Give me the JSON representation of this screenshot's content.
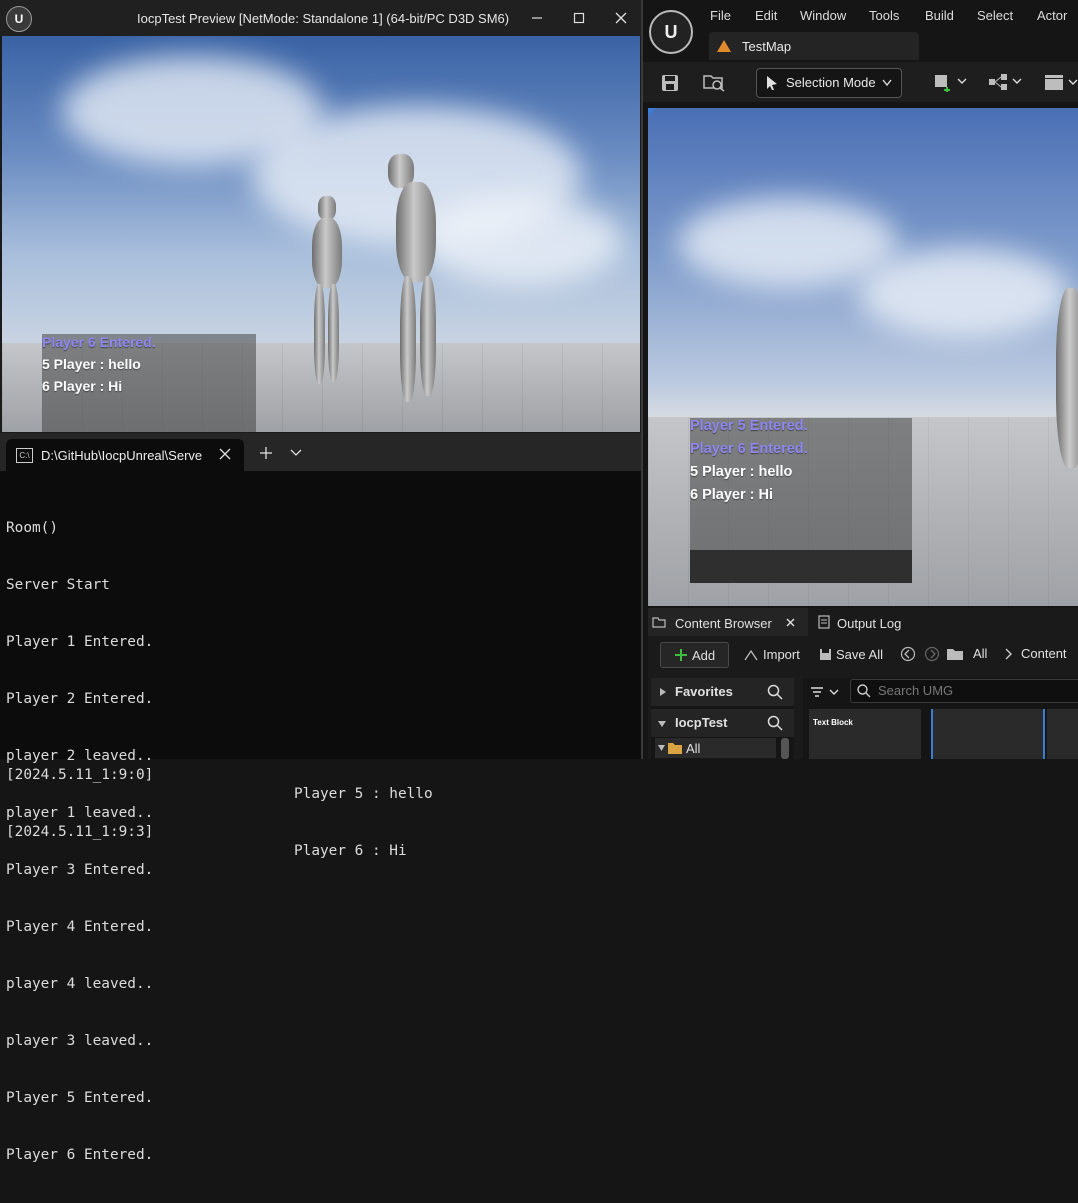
{
  "preview_window": {
    "title": "IocpTest Preview [NetMode: Standalone 1]  (64-bit/PC D3D SM6)",
    "chat": [
      {
        "text": "Player 6 Entered.",
        "color": "#8f86f0"
      },
      {
        "text": "5 Player : hello",
        "color": "#ffffff"
      },
      {
        "text": "6 Player : Hi",
        "color": "#ffffff"
      }
    ]
  },
  "terminal": {
    "tab_title": "D:\\GitHub\\IocpUnreal\\Serve",
    "lines": [
      "Room()",
      "Server Start",
      "Player 1 Entered.",
      "Player 2 Entered.",
      "player 2 leaved..",
      "player 1 leaved..",
      "Player 3 Entered.",
      "Player 4 Entered.",
      "player 4 leaved..",
      "player 3 leaved..",
      "Player 5 Entered.",
      "Player 6 Entered."
    ],
    "log": [
      {
        "time": "[2024.5.11_1:9:0]",
        "message": "Player 5 : hello"
      },
      {
        "time": "[2024.5.11_1:9:3]",
        "message": "Player 6 : Hi"
      }
    ]
  },
  "editor": {
    "menu": [
      "File",
      "Edit",
      "Window",
      "Tools",
      "Build",
      "Select",
      "Actor"
    ],
    "map_tab": "TestMap",
    "selection_mode": "Selection Mode",
    "chat": [
      {
        "text": "Player 5 Entered.",
        "color": "#8f86f0"
      },
      {
        "text": "Player 6 Entered.",
        "color": "#8f86f0"
      },
      {
        "text": "5 Player : hello",
        "color": "#ffffff"
      },
      {
        "text": "6 Player : Hi",
        "color": "#ffffff"
      }
    ],
    "content_browser": {
      "tab": "Content Browser",
      "output_log_tab": "Output Log",
      "add": "Add",
      "import": "Import",
      "save_all": "Save All",
      "path": [
        "All",
        "Content"
      ],
      "favorites": "Favorites",
      "project": "IocpTest",
      "tree_all": "All",
      "search_placeholder": "Search UMG",
      "asset_label": "Text Block"
    }
  },
  "colors": {
    "accent_green": "#3fbf3f",
    "chat_entered": "#8f86f0",
    "folder": "#d9a441"
  }
}
